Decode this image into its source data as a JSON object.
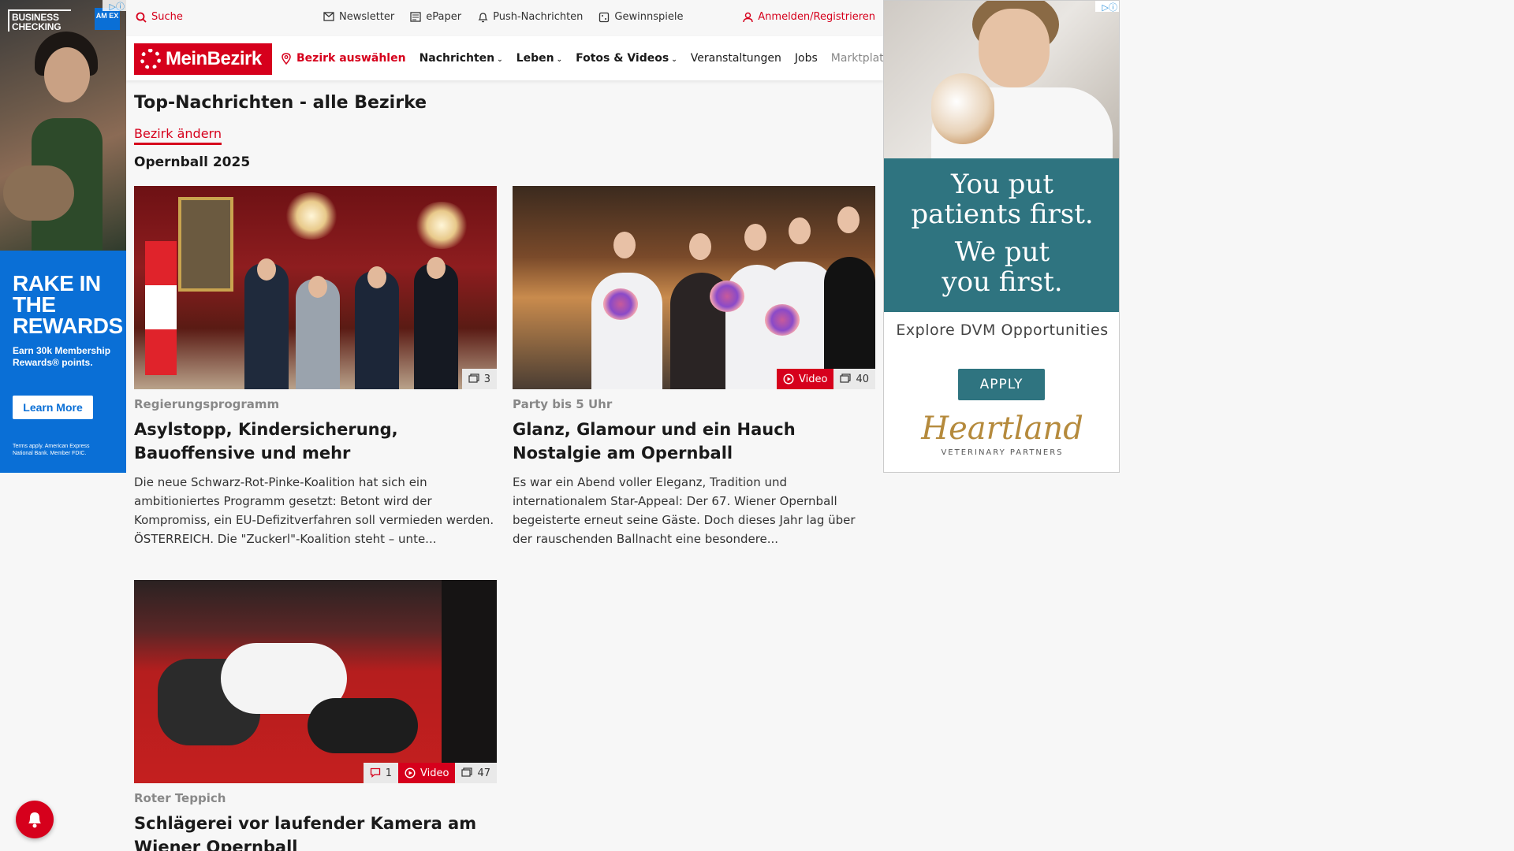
{
  "ad_left": {
    "brand": "BUSINESS CHECKING",
    "amex": "AM EX",
    "headline": "RAKE IN THE REWARDS",
    "subline": "Earn 30k Membership Rewards® points.",
    "cta": "Learn More",
    "terms": "Terms apply. American Express National Bank. Member FDIC."
  },
  "topbar": {
    "search_label": "Suche",
    "newsletter": "Newsletter",
    "epaper": "ePaper",
    "push": "Push-Nachrichten",
    "gewinnspiele": "Gewinnspiele",
    "login": "Anmelden/Registrieren"
  },
  "nav": {
    "logo": "MeinBezirk",
    "bezirk_select": "Bezirk auswählen",
    "nachrichten": "Nachrichten",
    "leben": "Leben",
    "fotos": "Fotos & Videos",
    "veranstaltungen": "Veranstaltungen",
    "jobs": "Jobs",
    "marktplatz": "Marktplatz"
  },
  "content": {
    "page_title": "Top-Nachrichten - alle Bezirke",
    "change_bezirk": "Bezirk ändern",
    "section_title": "Opernball 2025"
  },
  "articles": [
    {
      "category": "Regierungsprogramm",
      "headline": "Asylstopp, Kindersicherung, Bauoffensive und mehr",
      "teaser": "Die neue Schwarz-Rot-Pinke-Koalition hat sich ein ambitioniertes Programm gesetzt: Betont wird der Kompromiss, ein EU-Defizitverfahren soll vermieden werden.  ÖSTERREICH. Die \"Zuckerl\"-Koalition steht – unte...",
      "photo_count": "3"
    },
    {
      "category": "Party bis 5 Uhr",
      "headline": "Glanz, Glamour und ein Hauch Nostalgie am Opernball",
      "teaser": "Es war ein Abend voller Eleganz, Tradition und internationalem Star-Appeal: Der 67. Wiener Opernball begeisterte erneut seine Gäste. Doch dieses Jahr lag über der rauschenden Ballnacht eine besondere...",
      "video_label": "Video",
      "photo_count": "40"
    },
    {
      "category": "Roter Teppich",
      "headline": "Schlägerei vor laufender Kamera am Wiener Opernball",
      "comment_count": "1",
      "video_label": "Video",
      "photo_count": "47"
    }
  ],
  "ad_right": {
    "line1": "You put",
    "line2": "patients first.",
    "line3": "We put",
    "line4": "you first.",
    "explore": "Explore DVM Opportunities",
    "cta": "APPLY",
    "logo": "Heartland",
    "logo_sub": "VETERINARY PARTNERS"
  },
  "colors": {
    "brand_red": "#d6001c",
    "ad_teal": "#2f7480",
    "amex_blue": "#0a6fd6"
  },
  "icons": [
    "search-icon",
    "mail-icon",
    "newspaper-icon",
    "bell-icon",
    "gift-icon",
    "user-icon",
    "location-pin-icon",
    "chevron-down-icon",
    "image-gallery-icon",
    "play-icon",
    "comment-icon"
  ]
}
